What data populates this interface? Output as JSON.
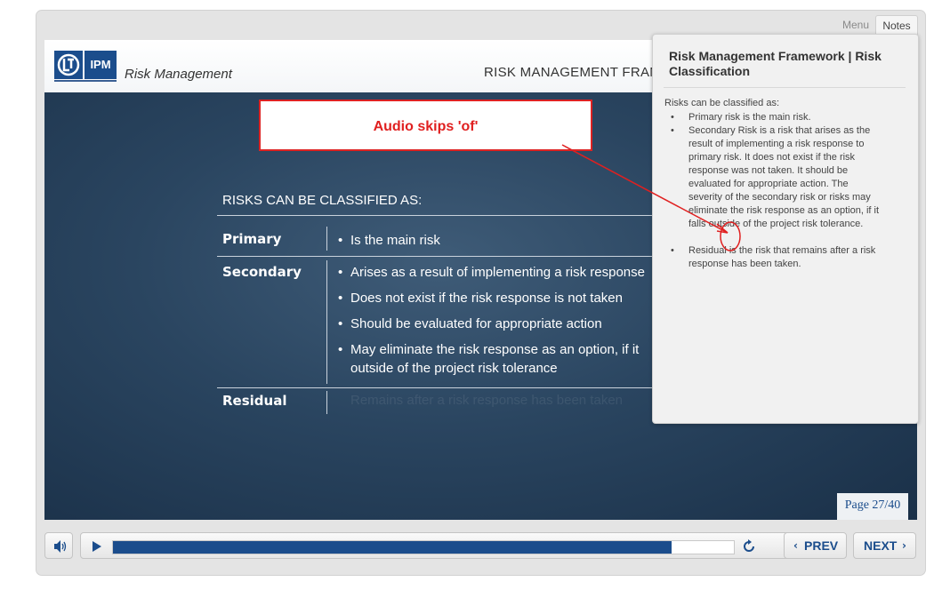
{
  "tabs": {
    "menu": "Menu",
    "notes": "Notes"
  },
  "header": {
    "logo_text": "IPM",
    "app_title": "Risk Management",
    "slide_title": "RISK MANAGEMENT FRAMEW"
  },
  "callout": {
    "text": "Audio skips 'of'"
  },
  "slide": {
    "heading": "RISKS CAN BE CLASSIFIED AS:",
    "rows": [
      {
        "label": "Primary",
        "bullets": [
          "Is the main risk"
        ]
      },
      {
        "label": "Secondary",
        "bullets": [
          "Arises as a result of implementing a risk response",
          "Does not exist if the risk response is not taken",
          "Should be evaluated for appropriate action",
          "May eliminate the risk response as an option, if it",
          "outside of the project risk tolerance"
        ]
      },
      {
        "label": "Residual",
        "bullets": [
          "Remains after a risk response has been taken"
        ]
      }
    ],
    "bullet_char": "•"
  },
  "notes": {
    "title": "Risk Management Framework | Risk Classification",
    "intro": "Risks can be classified as:",
    "items": [
      "Primary risk is the main risk.",
      "Secondary Risk is a risk that arises as the result of implementing a risk response to primary risk. It does not exist if the risk response was not taken. It should be evaluated for appropriate action. The severity of the secondary risk or risks may eliminate the risk response as an option, if it falls outside of the project risk tolerance.",
      "Residual is the risk that remains after a risk response has been taken."
    ]
  },
  "page_counter": "Page 27/40",
  "player": {
    "progress": 0.9
  },
  "nav": {
    "prev": "PREV",
    "next": "NEXT"
  },
  "colors": {
    "brand_blue": "#1b4d8c",
    "annotation_red": "#e02020"
  }
}
